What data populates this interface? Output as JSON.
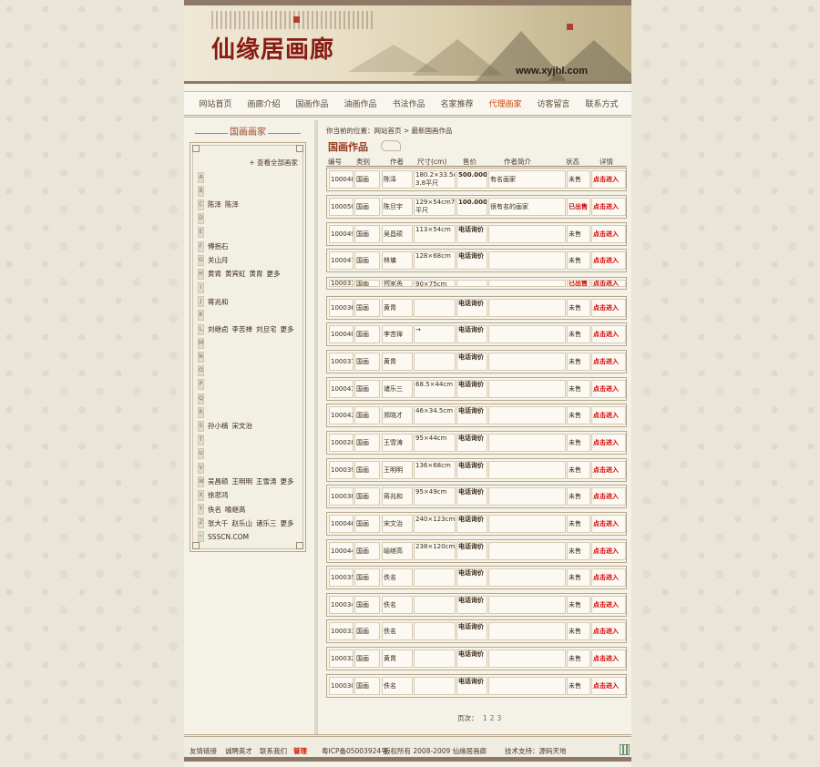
{
  "site": {
    "title": "仙缘居画廊",
    "url": "www.xyjhl.com"
  },
  "nav": {
    "items": [
      {
        "label": "网站首页",
        "active": false
      },
      {
        "label": "画廊介绍",
        "active": false
      },
      {
        "label": "国画作品",
        "active": false
      },
      {
        "label": "油画作品",
        "active": false
      },
      {
        "label": "书法作品",
        "active": false
      },
      {
        "label": "名家推荐",
        "active": false
      },
      {
        "label": "代理画家",
        "active": true
      },
      {
        "label": "访客留言",
        "active": false
      },
      {
        "label": "联系方式",
        "active": false
      }
    ]
  },
  "sidebar": {
    "title": "国画画家",
    "view_all": "+ 查看全部画家",
    "letters": [
      {
        "letter": "A",
        "artists": []
      },
      {
        "letter": "B",
        "artists": []
      },
      {
        "letter": "C",
        "artists": [
          "陈泽",
          "陈泽"
        ]
      },
      {
        "letter": "D",
        "artists": []
      },
      {
        "letter": "E",
        "artists": []
      },
      {
        "letter": "F",
        "artists": [
          "傅抱石"
        ]
      },
      {
        "letter": "G",
        "artists": [
          "关山月"
        ]
      },
      {
        "letter": "H",
        "artists": [
          "黄胄",
          "黄宾虹",
          "黄胄",
          "更多"
        ]
      },
      {
        "letter": "I",
        "artists": []
      },
      {
        "letter": "J",
        "artists": [
          "蒋兆和"
        ]
      },
      {
        "letter": "K",
        "artists": []
      },
      {
        "letter": "L",
        "artists": [
          "刘继卣",
          "李苦禅",
          "刘旦宅",
          "更多"
        ]
      },
      {
        "letter": "M",
        "artists": []
      },
      {
        "letter": "N",
        "artists": []
      },
      {
        "letter": "O",
        "artists": []
      },
      {
        "letter": "P",
        "artists": []
      },
      {
        "letter": "Q",
        "artists": []
      },
      {
        "letter": "R",
        "artists": []
      },
      {
        "letter": "S",
        "artists": [
          "孙小楠",
          "宋文治"
        ]
      },
      {
        "letter": "T",
        "artists": []
      },
      {
        "letter": "U",
        "artists": []
      },
      {
        "letter": "V",
        "artists": []
      },
      {
        "letter": "W",
        "artists": [
          "吴昌硕",
          "王明明",
          "王雪涛",
          "更多"
        ]
      },
      {
        "letter": "X",
        "artists": [
          "徐悲鸿"
        ]
      },
      {
        "letter": "Y",
        "artists": [
          "佚名",
          "喻继高"
        ]
      },
      {
        "letter": "Z",
        "artists": [
          "张大千",
          "赵乐山",
          "诸乐三",
          "更多"
        ]
      },
      {
        "letter": "~",
        "artists": [
          "SSSCN.COM"
        ]
      }
    ]
  },
  "breadcrumb": "你当前的位置：网站首页 > 最新国画作品",
  "section_title": "国画作品",
  "table": {
    "headers": [
      "编号",
      "类别",
      "作者",
      "尺寸(cm)",
      "售价",
      "作者简介",
      "状态",
      "详情"
    ],
    "rows": [
      {
        "id": "100048",
        "cat": "国画",
        "author": "陈泽",
        "size": "180.2×33.5cm 3.8平尺",
        "price": "500.000",
        "intro": "有名画家",
        "status": "未售",
        "detail": "点击进入",
        "price_bold": true,
        "sold": false
      },
      {
        "id": "100050",
        "cat": "国画",
        "author": "陈旦宇",
        "size": "129×54cm7.5平尺",
        "price": "100.000",
        "intro": "很有名的画家",
        "status": "已出售",
        "detail": "点击进入",
        "price_bold": true,
        "sold": true
      },
      {
        "id": "100049",
        "cat": "国画",
        "author": "吴昌硕",
        "size": "113×54cm",
        "price": "电话询价",
        "intro": "",
        "status": "未售",
        "detail": "点击进入",
        "price_bold": true,
        "sold": false
      },
      {
        "id": "100047",
        "cat": "国画",
        "author": "林墉",
        "size": "128×68cm",
        "price": "电话询价",
        "intro": "",
        "status": "未售",
        "detail": "点击进入",
        "price_bold": true,
        "sold": false
      },
      {
        "id": "100031",
        "cat": "国画",
        "author": "何家英",
        "size": "90×75cm",
        "price": "",
        "intro": "",
        "status": "已出售",
        "detail": "点击进入",
        "price_bold": false,
        "sold": true
      },
      {
        "id": "100036",
        "cat": "国画",
        "author": "黄胄",
        "size": "",
        "price": "电话询价",
        "intro": "",
        "status": "未售",
        "detail": "点击进入",
        "price_bold": true,
        "sold": false
      },
      {
        "id": "100040",
        "cat": "国画",
        "author": "李苦禅",
        "size": "→",
        "price": "电话询价",
        "intro": "",
        "status": "未售",
        "detail": "点击进入",
        "price_bold": true,
        "sold": false
      },
      {
        "id": "100037",
        "cat": "国画",
        "author": "黄胄",
        "size": "",
        "price": "电话询价",
        "intro": "",
        "status": "未售",
        "detail": "点击进入",
        "price_bold": true,
        "sold": false
      },
      {
        "id": "100041",
        "cat": "国画",
        "author": "诸乐三",
        "size": "68.5×44cm",
        "price": "电话询价",
        "intro": "",
        "status": "未售",
        "detail": "点击进入",
        "price_bold": true,
        "sold": false
      },
      {
        "id": "100042",
        "cat": "国画",
        "author": "郑晓才",
        "size": "46×34.5cm",
        "price": "电话询价",
        "intro": "",
        "status": "未售",
        "detail": "点击进入",
        "price_bold": true,
        "sold": false
      },
      {
        "id": "100028",
        "cat": "国画",
        "author": "王雪涛",
        "size": "95×44cm",
        "price": "电话询价",
        "intro": "",
        "status": "未售",
        "detail": "点击进入",
        "price_bold": true,
        "sold": false
      },
      {
        "id": "100039",
        "cat": "国画",
        "author": "王明明",
        "size": "136×68cm",
        "price": "电话询价",
        "intro": "",
        "status": "未售",
        "detail": "点击进入",
        "price_bold": true,
        "sold": false
      },
      {
        "id": "100038",
        "cat": "国画",
        "author": "蒋兆和",
        "size": "95×49cm",
        "price": "电话询价",
        "intro": "",
        "status": "未售",
        "detail": "点击进入",
        "price_bold": true,
        "sold": false
      },
      {
        "id": "100046",
        "cat": "国画",
        "author": "宋文治",
        "size": "240×123cm",
        "price": "电话询价",
        "intro": "",
        "status": "未售",
        "detail": "点击进入",
        "price_bold": true,
        "sold": false
      },
      {
        "id": "100044",
        "cat": "国画",
        "author": "喻继高",
        "size": "238×120cm",
        "price": "电话询价",
        "intro": "",
        "status": "未售",
        "detail": "点击进入",
        "price_bold": true,
        "sold": false
      },
      {
        "id": "100035",
        "cat": "国画",
        "author": "佚名",
        "size": "",
        "price": "电话询价",
        "intro": "",
        "status": "未售",
        "detail": "点击进入",
        "price_bold": true,
        "sold": false
      },
      {
        "id": "100034",
        "cat": "国画",
        "author": "佚名",
        "size": "",
        "price": "电话询价",
        "intro": "",
        "status": "未售",
        "detail": "点击进入",
        "price_bold": true,
        "sold": false
      },
      {
        "id": "100033",
        "cat": "国画",
        "author": "佚名",
        "size": "",
        "price": "电话询价",
        "intro": "",
        "status": "未售",
        "detail": "点击进入",
        "price_bold": true,
        "sold": false
      },
      {
        "id": "100032",
        "cat": "国画",
        "author": "黄胄",
        "size": "",
        "price": "电话询价",
        "intro": "",
        "status": "未售",
        "detail": "点击进入",
        "price_bold": true,
        "sold": false
      },
      {
        "id": "100030",
        "cat": "国画",
        "author": "佚名",
        "size": "",
        "price": "电话询价",
        "intro": "",
        "status": "未售",
        "detail": "点击进入",
        "price_bold": true,
        "sold": false
      }
    ]
  },
  "pager": {
    "label": "页次：",
    "pages": [
      "1",
      "2",
      "3"
    ]
  },
  "footer": {
    "links": [
      "友情链接",
      "诚聘英才",
      "联系我们"
    ],
    "admin": "管理",
    "icp": "粤ICP备05003924号",
    "copyright": "版权所有 2008-2009 仙缘居画廊",
    "support": "技术支持：源码天地"
  },
  "colors": {
    "accent_red": "#cc0000",
    "nav_active": "#d24a10",
    "frame": "#8e7866"
  }
}
